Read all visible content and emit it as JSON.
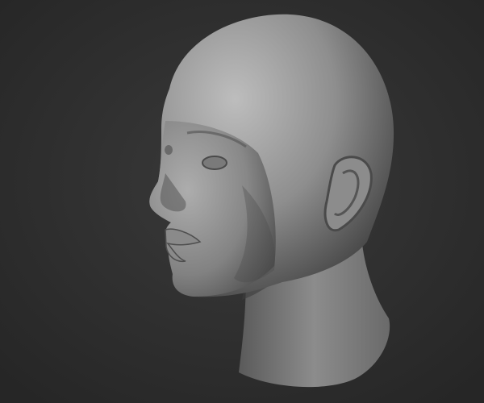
{
  "scene": {
    "subject": "head-sculpt",
    "colors": {
      "background_center": "#3a3a3a",
      "background_edge": "#262626",
      "skin_light": "#b4b4b4",
      "skin_mid": "#8a8a8a",
      "skin_shadow": "#3e3e3e"
    }
  }
}
